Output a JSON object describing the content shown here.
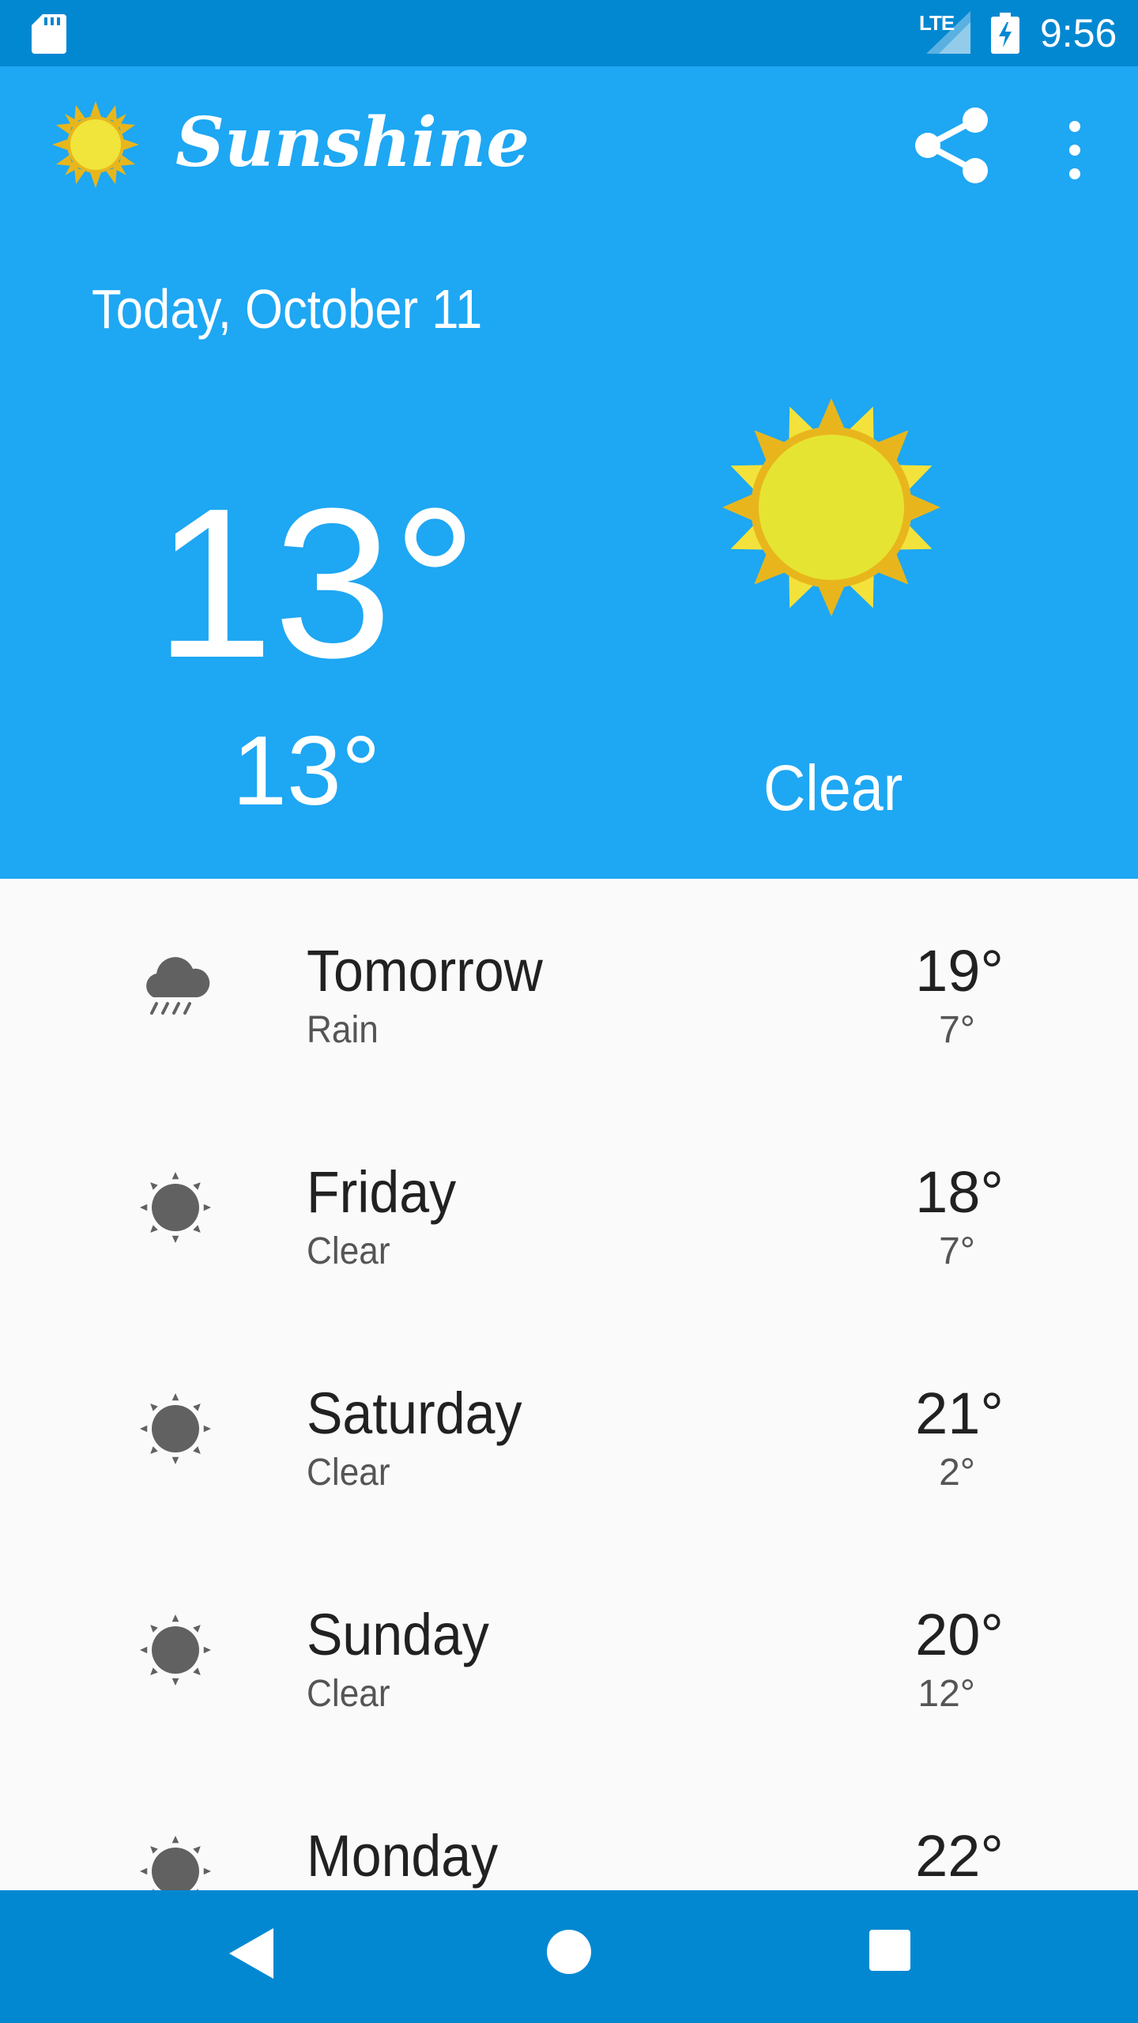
{
  "status_bar": {
    "network": "LTE",
    "time": "9:56",
    "icons": [
      "sd-card-icon",
      "signal-icon",
      "battery-charging-icon"
    ]
  },
  "app_bar": {
    "title": "Sunshine",
    "logo_icon": "sun-logo-icon",
    "actions": [
      "share-icon",
      "overflow-menu-icon"
    ]
  },
  "today": {
    "date": "Today, October 11",
    "high": "13°",
    "low": "13°",
    "description": "Clear",
    "icon": "sun-art-icon"
  },
  "forecast": [
    {
      "day": "Tomorrow",
      "description": "Rain",
      "high": "19°",
      "low": "7°",
      "icon": "rain-icon"
    },
    {
      "day": "Friday",
      "description": "Clear",
      "high": "18°",
      "low": "7°",
      "icon": "clear-icon"
    },
    {
      "day": "Saturday",
      "description": "Clear",
      "high": "21°",
      "low": "2°",
      "icon": "clear-icon"
    },
    {
      "day": "Sunday",
      "description": "Clear",
      "high": "20°",
      "low": "12°",
      "icon": "clear-icon"
    },
    {
      "day": "Monday",
      "description": "",
      "high": "22°",
      "low": "",
      "icon": "clear-icon"
    }
  ],
  "nav_bar": {
    "buttons": [
      "back-icon",
      "home-icon",
      "recents-icon"
    ]
  },
  "colors": {
    "status_bar": "#0288D1",
    "header": "#1EA7F3",
    "list_background": "#FAFAFA",
    "sun_yellow": "#F1D92C",
    "sun_orange": "#E8B61C",
    "list_icon_gray": "#616161"
  }
}
